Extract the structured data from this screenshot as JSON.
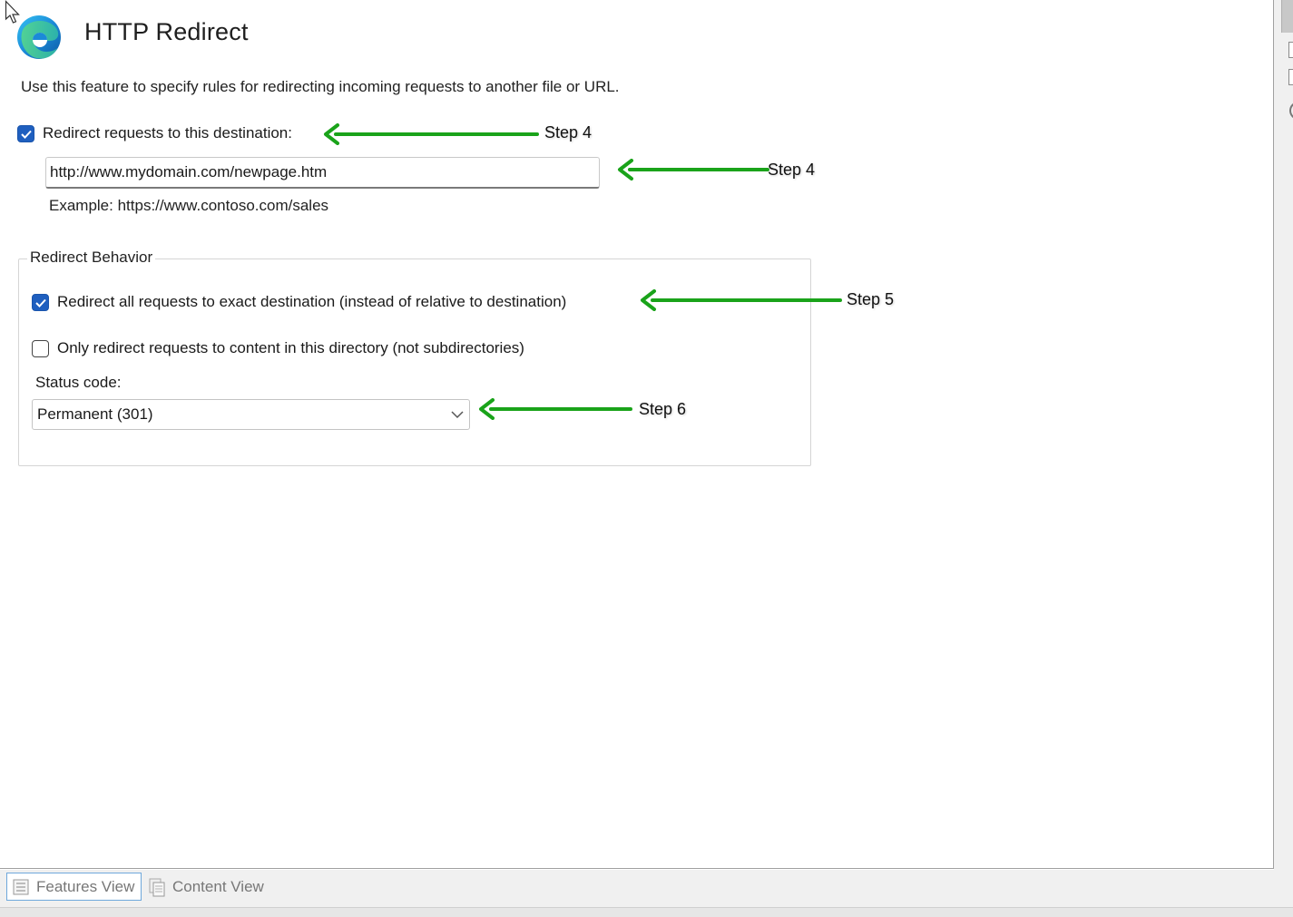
{
  "header": {
    "title": "HTTP Redirect",
    "logo_icon": "edge-browser-icon"
  },
  "description": "Use this feature to specify rules for redirecting incoming requests to another file or URL.",
  "redirect_destination": {
    "checkbox_label": "Redirect requests to this destination:",
    "checked": true,
    "value": "http://www.mydomain.com/newpage.htm",
    "example": "Example: https://www.contoso.com/sales"
  },
  "redirect_behavior": {
    "legend": "Redirect Behavior",
    "exact_destination": {
      "label": "Redirect all requests to exact destination (instead of relative to destination)",
      "checked": true
    },
    "only_this_directory": {
      "label": "Only redirect requests to content in this directory (not subdirectories)",
      "checked": false
    },
    "status_code": {
      "label": "Status code:",
      "selected": "Permanent (301)"
    }
  },
  "annotations": {
    "color": "#1aa31a",
    "steps": [
      "Step 4",
      "Step 4",
      "Step 5",
      "Step 6"
    ]
  },
  "bottom_tabs": {
    "features_view": "Features View",
    "content_view": "Content View",
    "active": "Features View"
  },
  "colors": {
    "checkbox_checked": "#1f5fbf",
    "active_tab_border": "#6fa8dc"
  }
}
